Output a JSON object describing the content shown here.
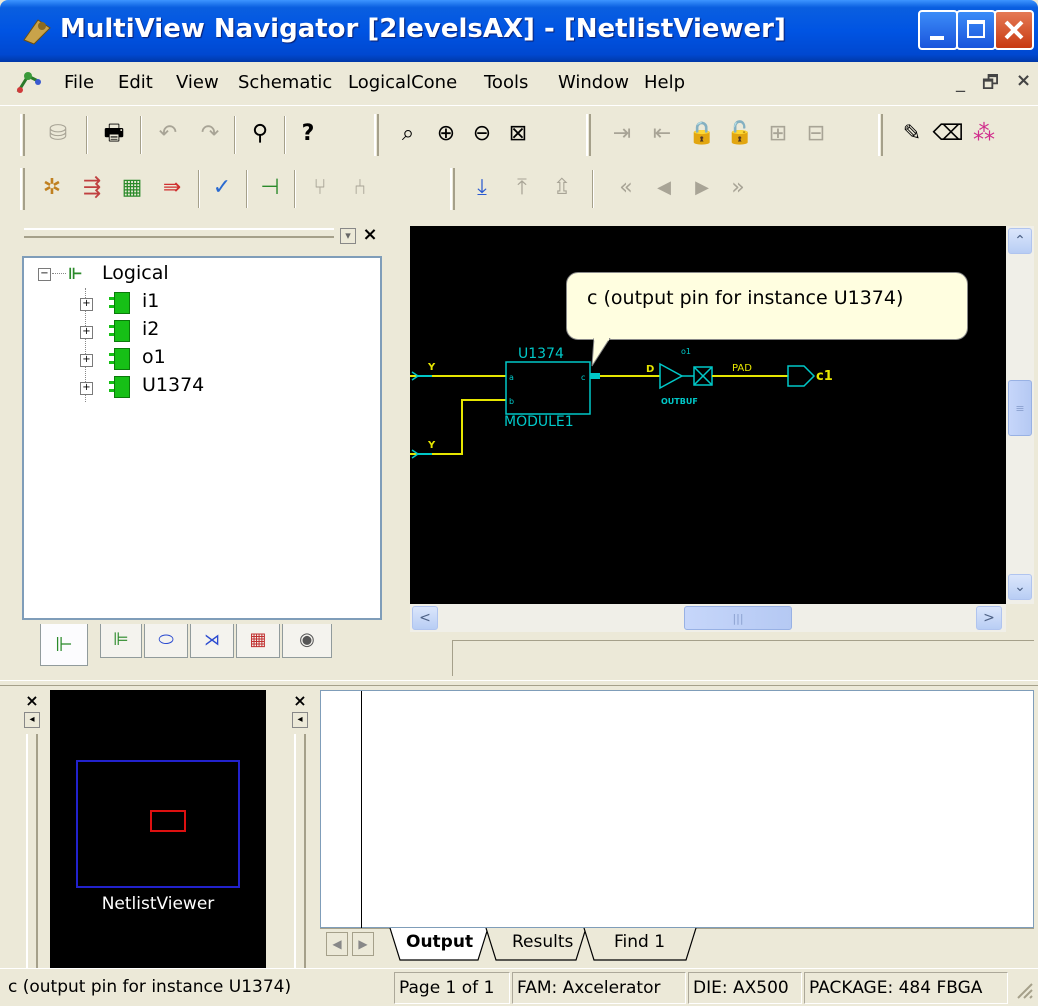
{
  "window": {
    "title": "MultiView Navigator [2levelsAX] - [NetlistViewer]"
  },
  "menu": [
    "File",
    "Edit",
    "View",
    "Schematic",
    "LogicalCone",
    "Tools",
    "Window",
    "Help"
  ],
  "toolbar1_icons": [
    "database-icon",
    "print-icon",
    "undo-icon",
    "redo-icon",
    "find-icon",
    "help-icon",
    "zoom-icon",
    "zoom-in-icon",
    "zoom-out-icon",
    "zoom-fit-icon",
    "push-in-icon",
    "pop-out-icon",
    "lock-icon",
    "unlock-icon",
    "expand-icon",
    "collapse-icon",
    "pencil-icon",
    "eraser-icon",
    "color-icon"
  ],
  "toolbar2_icons": [
    "cone-icon",
    "netlist-icon",
    "schematic-icon",
    "trace-icon",
    "select-icon",
    "hierarchy-icon",
    "branch-icon",
    "merge-icon",
    "import-icon",
    "export-icon",
    "export-all-icon",
    "first-icon",
    "prev-icon",
    "next-icon",
    "last-icon"
  ],
  "tree": {
    "root": "Logical",
    "children": [
      "i1",
      "i2",
      "o1",
      "U1374"
    ]
  },
  "tree_tabs": [
    "logical-tab-icon",
    "physical-tab-icon",
    "cell-tab-icon",
    "net-tab-icon",
    "chip-tab-icon",
    "eye-tab-icon"
  ],
  "schematic": {
    "instance_name": "U1374",
    "module_name": "MODULE1",
    "pin_a": "a",
    "pin_b": "b",
    "pin_c": "c",
    "input_net_1": "Y",
    "input_net_2": "Y",
    "buf_label": "o1",
    "buf_pin_d": "D",
    "buf_pin_pad": "PAD",
    "buf_name": "OUTBUF",
    "output_port": "c1",
    "colors": {
      "wire": "#e6e600",
      "symbol": "#00c8c8",
      "background": "#000000",
      "port": "#e6e600"
    }
  },
  "tooltip": "c (output pin for instance U1374)",
  "birdseye": {
    "label": "NetlistViewer"
  },
  "output_tabs": [
    "Output",
    "Results",
    "Find 1"
  ],
  "output_tabs_active": "Output",
  "status": {
    "message": "c (output pin for instance U1374)",
    "page": "Page 1 of 1",
    "fam": "FAM: Axcelerator",
    "die": "DIE: AX500",
    "package": "PACKAGE: 484 FBGA"
  }
}
